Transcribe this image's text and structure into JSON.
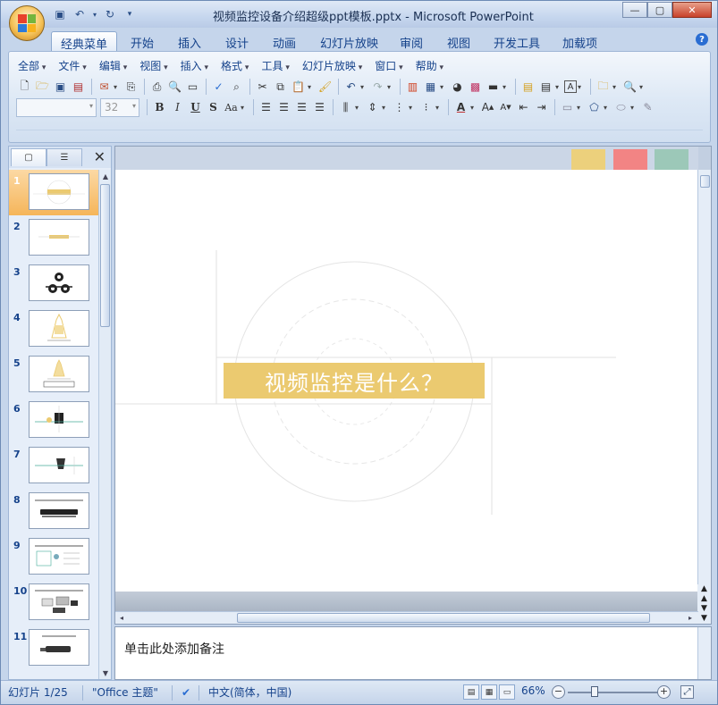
{
  "window": {
    "title": "视频监控设备介绍超级ppt模板.pptx - Microsoft PowerPoint",
    "qat": [
      {
        "name": "save-icon",
        "glyph": "▣"
      },
      {
        "name": "undo-icon",
        "glyph": "↶"
      },
      {
        "name": "dropdown-icon",
        "glyph": "▾"
      },
      {
        "name": "redo-icon",
        "glyph": "↻"
      },
      {
        "name": "customize-icon",
        "glyph": "₸"
      }
    ],
    "controls": {
      "minimize": "—",
      "maximize": "▢",
      "close": "✕"
    }
  },
  "ribbon_tabs": [
    "经典菜单",
    "开始",
    "插入",
    "设计",
    "动画",
    "幻灯片放映",
    "审阅",
    "视图",
    "开发工具",
    "加载项"
  ],
  "classic_menu": [
    "全部",
    "文件",
    "编辑",
    "视图",
    "插入",
    "格式",
    "工具",
    "幻灯片放映",
    "窗口",
    "帮助"
  ],
  "toolbar": {
    "font_size": "32",
    "format_buttons": {
      "bold": "B",
      "italic": "I",
      "underline": "U",
      "shadow": "S",
      "case": "Aa"
    }
  },
  "thumbnails": [
    "1",
    "2",
    "3",
    "4",
    "5",
    "6",
    "7",
    "8",
    "9",
    "10",
    "11"
  ],
  "slide": {
    "title": "视频监控是什么？"
  },
  "swatch_colors": [
    "#ecd07c",
    "#f28484",
    "#9cc8b8"
  ],
  "accent_color": "#ebca70",
  "notes": {
    "placeholder": "单击此处添加备注"
  },
  "status": {
    "slide_info": "幻灯片 1/25",
    "theme": "\"Office 主题\"",
    "language": "中文(简体，中国)",
    "zoom": "66%"
  }
}
